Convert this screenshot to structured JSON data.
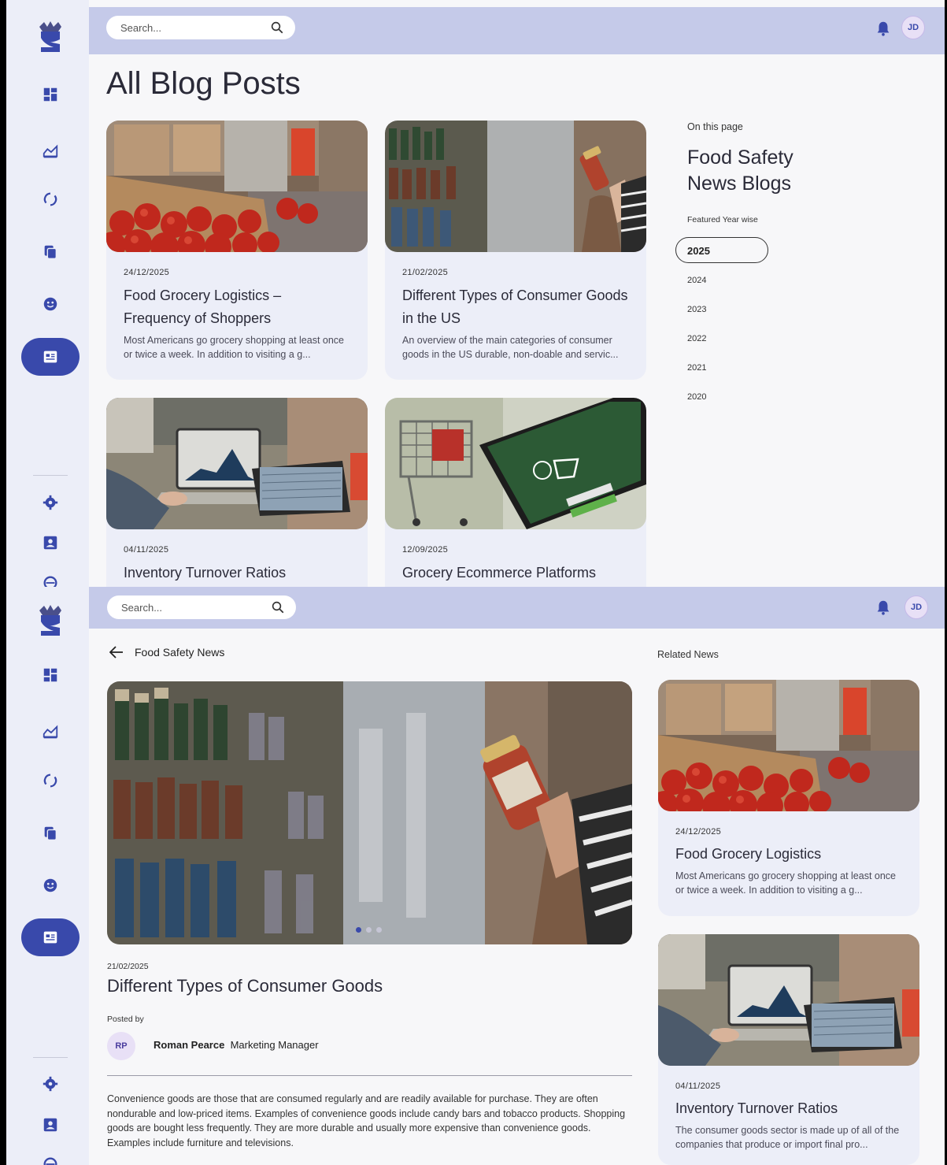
{
  "shared": {
    "search_placeholder": "Search...",
    "user_initials": "JD",
    "nav": [
      "dashboard-icon",
      "analytics-icon",
      "cycle-icon",
      "copy-icon",
      "support-icon",
      "news-icon",
      "settings-icon",
      "profile-icon",
      "more-icon"
    ]
  },
  "list_screen": {
    "page_title": "All Blog Posts",
    "cards": [
      {
        "date": "24/12/2025",
        "title": "Food Grocery Logistics – Frequency of Shoppers",
        "desc": "Most Americans go grocery shopping at least once or twice a week. In addition to visiting a g..."
      },
      {
        "date": "21/02/2025",
        "title": "Different Types of Consumer Goods in the US",
        "desc": "An overview of the main categories of consumer goods in the US durable, non-doable and servic..."
      },
      {
        "date": "04/11/2025",
        "title": "Inventory Turnover Ratios",
        "desc": ""
      },
      {
        "date": "12/09/2025",
        "title": "Grocery Ecommerce Platforms",
        "desc": ""
      }
    ],
    "on_this_page": {
      "label": "On this page",
      "title": "Food Safety News Blogs",
      "featured_label": "Featured Year wise",
      "years": [
        "2025",
        "2024",
        "2023",
        "2022",
        "2021",
        "2020"
      ],
      "selected_year": "2025"
    }
  },
  "detail_screen": {
    "back_label": "Food Safety News",
    "date": "21/02/2025",
    "title": "Different Types of Consumer Goods",
    "posted_by_label": "Posted by",
    "author_initials": "RP",
    "author_name": "Roman Pearce",
    "author_role": "Marketing Manager",
    "paragraph": "Convenience goods are those that are consumed regularly and are readily available for purchase. They are often nondurable and low-priced items. Examples of convenience goods include candy bars and tobacco products. Shopping goods are bought less frequently. They are more durable and usually more expensive than convenience goods. Examples include furniture and televisions.",
    "related_label": "Related News",
    "related": [
      {
        "date": "24/12/2025",
        "title": "Food Grocery Logistics",
        "desc": "Most Americans go grocery shopping at least once or twice a week. In addition to visiting a g..."
      },
      {
        "date": "04/11/2025",
        "title": "Inventory Turnover Ratios",
        "desc": "The consumer goods sector is made up of all of the companies that produce or import final pro..."
      }
    ]
  },
  "colors": {
    "accent": "#3949ab",
    "topbar": "#c5cae9",
    "sidebar": "#eceef8"
  }
}
